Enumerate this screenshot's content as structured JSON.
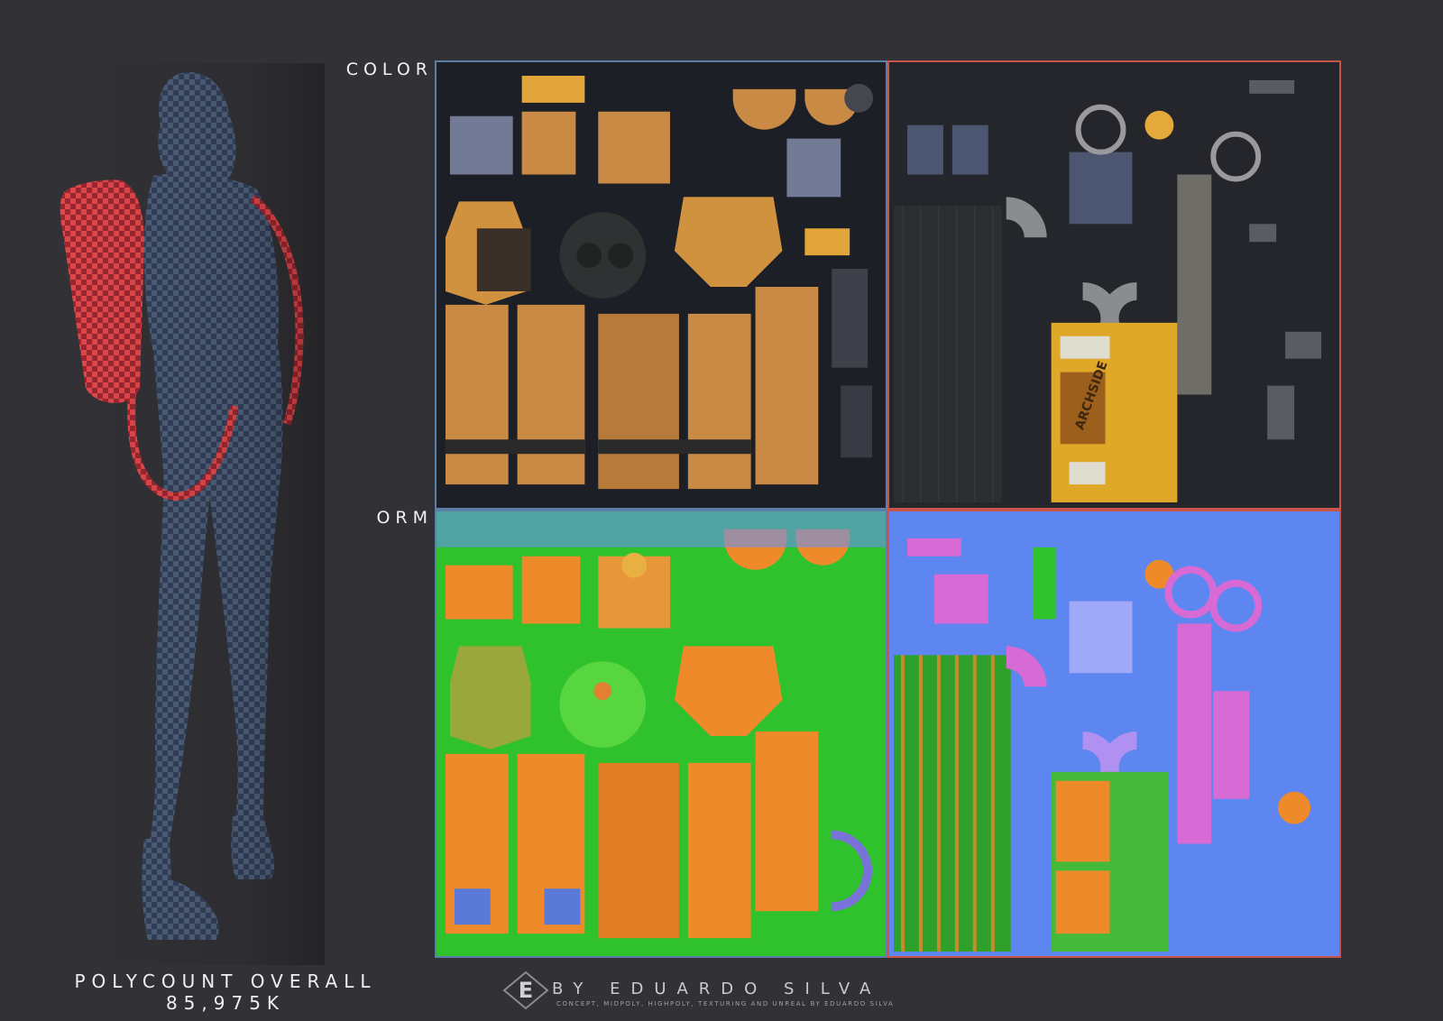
{
  "labels": {
    "color": "COLOR",
    "orm": "ORM"
  },
  "footer": {
    "polycount_title": "POLYCOUNT OVERALL",
    "polycount_value": "85,975K"
  },
  "author": {
    "logo_letter": "E",
    "name": "BY EDUARDO SILVA",
    "credit": "CONCEPT, MIDPOLY, HIGHPOLY, TEXTURING AND UNREAL BY EDUARDO SILVA"
  },
  "texture_decal_text": "ARCHSIDE",
  "colors": {
    "background": "#323236",
    "suit_checker_a": "#4e5f78",
    "suit_checker_b": "#33405a",
    "pack_checker_a": "#e0474b",
    "pack_checker_b": "#9a2730",
    "char_border": "#5b7fa6",
    "prop_border": "#c8554c",
    "fabric_orange": "#c98a45",
    "orm_green": "#2fc22d",
    "orm_orange": "#ee8a2a",
    "normal_blue": "#5d86f0",
    "normal_magenta": "#d86ad6",
    "decal_yellow": "#e0a829"
  }
}
